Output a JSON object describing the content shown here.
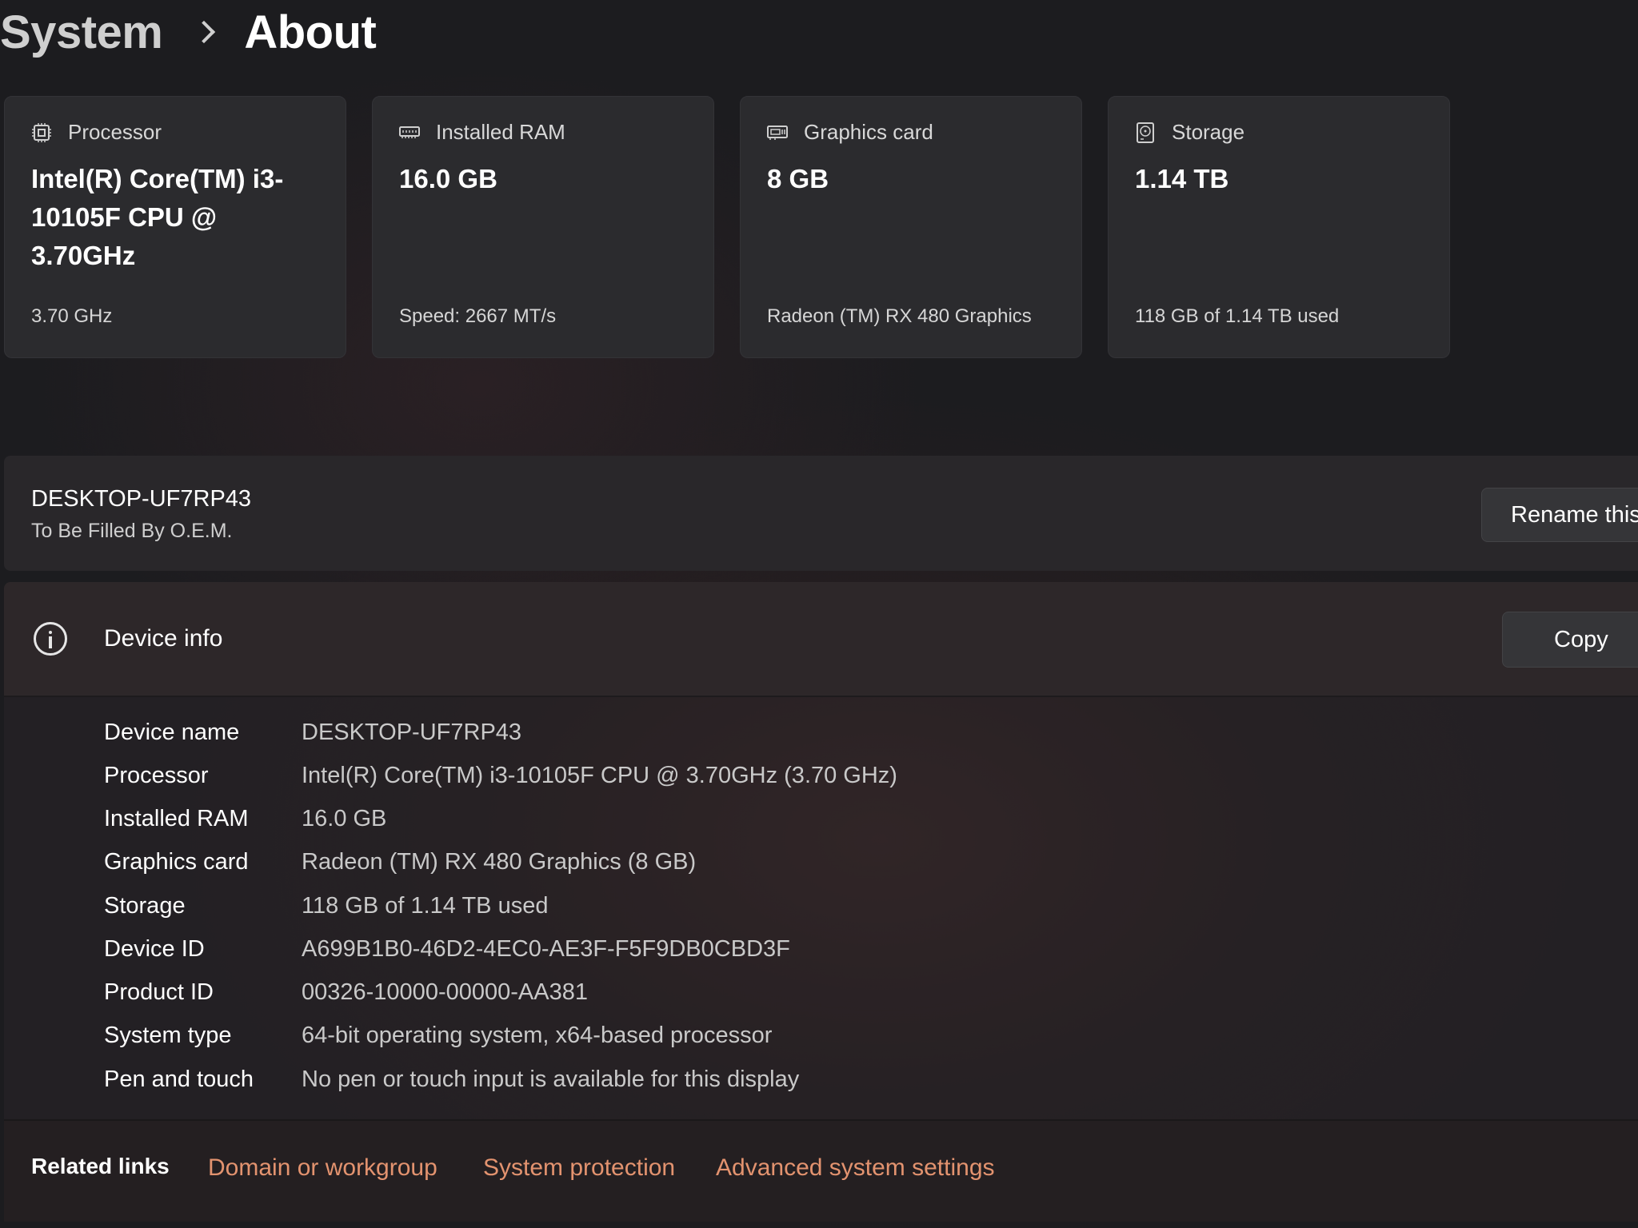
{
  "breadcrumb": {
    "parent": "System",
    "current": "About"
  },
  "cards": [
    {
      "label": "Processor",
      "icon": "processor-chip-icon",
      "value": "Intel(R) Core(TM) i3-10105F CPU @ 3.70GHz",
      "sub": "3.70 GHz"
    },
    {
      "label": "Installed RAM",
      "icon": "ram-module-icon",
      "value": "16.0 GB",
      "sub": "Speed: 2667 MT/s"
    },
    {
      "label": "Graphics card",
      "icon": "graphics-card-icon",
      "value": "8 GB",
      "sub": "Radeon (TM) RX 480 Graphics"
    },
    {
      "label": "Storage",
      "icon": "storage-drive-icon",
      "value": "1.14 TB",
      "sub": "118 GB of 1.14 TB used"
    }
  ],
  "device": {
    "name": "DESKTOP-UF7RP43",
    "model": "To Be Filled By O.E.M.",
    "rename_label": "Rename this"
  },
  "device_info": {
    "title": "Device info",
    "icon": "info-circle-icon",
    "copy_label": "Copy",
    "rows": [
      {
        "key": "Device name",
        "value": "DESKTOP-UF7RP43"
      },
      {
        "key": "Processor",
        "value": "Intel(R) Core(TM) i3-10105F CPU @ 3.70GHz (3.70 GHz)"
      },
      {
        "key": "Installed RAM",
        "value": "16.0 GB"
      },
      {
        "key": "Graphics card",
        "value": "Radeon (TM) RX 480 Graphics (8 GB)"
      },
      {
        "key": "Storage",
        "value": "118 GB of 1.14 TB used"
      },
      {
        "key": "Device ID",
        "value": "A699B1B0-46D2-4EC0-AE3F-F5F9DB0CBD3F"
      },
      {
        "key": "Product ID",
        "value": "00326-10000-00000-AA381"
      },
      {
        "key": "System type",
        "value": "64-bit operating system, x64-based processor"
      },
      {
        "key": "Pen and touch",
        "value": "No pen or touch input is available for this display"
      }
    ]
  },
  "related_links": {
    "title": "Related links",
    "links": [
      "Domain or workgroup",
      "System protection",
      "Advanced system settings"
    ],
    "link_color": "#e3936f"
  },
  "colors": {
    "background": "#1c1c1f",
    "card": "#2b2b2e",
    "accent_link": "#e3936f"
  }
}
